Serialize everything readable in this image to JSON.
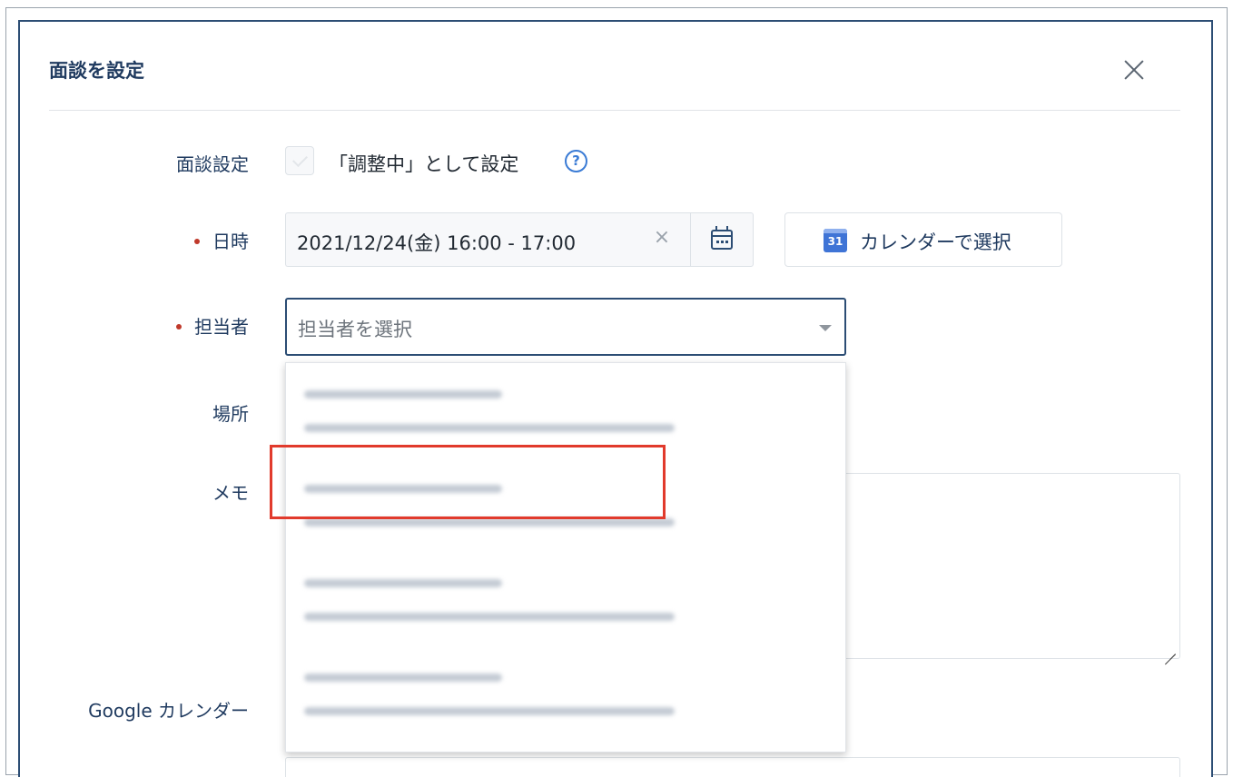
{
  "modal": {
    "title": "面談を設定"
  },
  "fields": {
    "interview_setting": {
      "label": "面談設定",
      "checkbox_label": "「調整中」として設定",
      "checked": false,
      "help_icon": "?"
    },
    "datetime": {
      "label": "日時",
      "required": true,
      "value": "2021/12/24(金) 16:00 - 17:00",
      "clear_glyph": "×",
      "calendar_button_label": "カレンダーで選択",
      "calendar_badge": "31"
    },
    "assignee": {
      "label": "担当者",
      "required": true,
      "placeholder": "担当者を選択"
    },
    "location": {
      "label": "場所"
    },
    "memo": {
      "label": "メモ"
    },
    "google_calendar": {
      "label": "Google カレンダー"
    }
  },
  "dropdown": {
    "options_count": 4,
    "highlighted_index": 1
  },
  "colors": {
    "primary": "#2c4d74",
    "required_dot": "#c0392b",
    "help_blue": "#3a7bd5",
    "highlight_red": "#e13a2c"
  }
}
